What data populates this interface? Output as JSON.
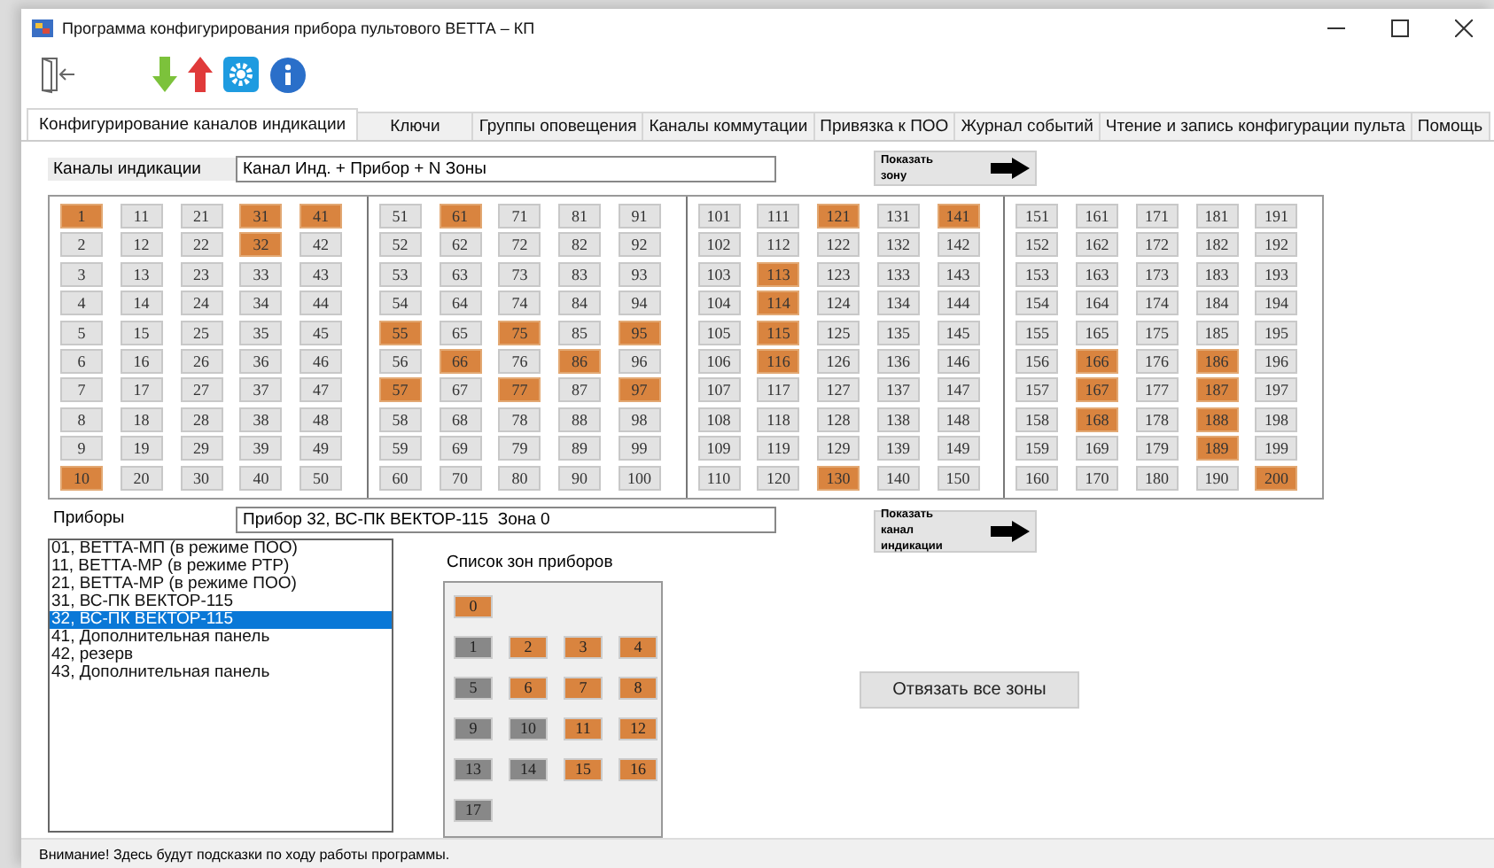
{
  "window": {
    "title": "Программа конфигурирования прибора пультового ВЕТТА – КП"
  },
  "tabs": [
    {
      "label": "Конфигурирование каналов индикации",
      "selected": true
    },
    {
      "label": "Ключи",
      "selected": false
    },
    {
      "label": "Группы оповещения",
      "selected": false
    },
    {
      "label": "Каналы коммутации",
      "selected": false
    },
    {
      "label": "Привязка к ПОО",
      "selected": false
    },
    {
      "label": "Журнал событий",
      "selected": false
    },
    {
      "label": "Чтение и запись конфигурации пульта",
      "selected": false
    },
    {
      "label": "Помощь",
      "selected": false
    }
  ],
  "channels_section": {
    "label": "Каналы индикации",
    "value": "Канал Инд. + Прибор + N Зоны",
    "show_button": "Показать зону"
  },
  "channels": [
    {
      "label": "1",
      "on": true
    },
    {
      "label": "2",
      "on": false
    },
    {
      "label": "3",
      "on": false
    },
    {
      "label": "4",
      "on": false
    },
    {
      "label": "5",
      "on": false
    },
    {
      "label": "6",
      "on": false
    },
    {
      "label": "7",
      "on": false
    },
    {
      "label": "8",
      "on": false
    },
    {
      "label": "9",
      "on": false
    },
    {
      "label": "10",
      "on": true
    },
    {
      "label": "11",
      "on": false
    },
    {
      "label": "12",
      "on": false
    },
    {
      "label": "13",
      "on": false
    },
    {
      "label": "14",
      "on": false
    },
    {
      "label": "15",
      "on": false
    },
    {
      "label": "16",
      "on": false
    },
    {
      "label": "17",
      "on": false
    },
    {
      "label": "18",
      "on": false
    },
    {
      "label": "19",
      "on": false
    },
    {
      "label": "20",
      "on": false
    },
    {
      "label": "21",
      "on": false
    },
    {
      "label": "22",
      "on": false
    },
    {
      "label": "23",
      "on": false
    },
    {
      "label": "24",
      "on": false
    },
    {
      "label": "25",
      "on": false
    },
    {
      "label": "26",
      "on": false
    },
    {
      "label": "27",
      "on": false
    },
    {
      "label": "28",
      "on": false
    },
    {
      "label": "29",
      "on": false
    },
    {
      "label": "30",
      "on": false
    },
    {
      "label": "31",
      "on": true
    },
    {
      "label": "32",
      "on": true
    },
    {
      "label": "33",
      "on": false
    },
    {
      "label": "34",
      "on": false
    },
    {
      "label": "35",
      "on": false
    },
    {
      "label": "36",
      "on": false
    },
    {
      "label": "37",
      "on": false
    },
    {
      "label": "38",
      "on": false
    },
    {
      "label": "39",
      "on": false
    },
    {
      "label": "40",
      "on": false
    },
    {
      "label": "41",
      "on": true
    },
    {
      "label": "42",
      "on": false
    },
    {
      "label": "43",
      "on": false
    },
    {
      "label": "44",
      "on": false
    },
    {
      "label": "45",
      "on": false
    },
    {
      "label": "46",
      "on": false
    },
    {
      "label": "47",
      "on": false
    },
    {
      "label": "48",
      "on": false
    },
    {
      "label": "49",
      "on": false
    },
    {
      "label": "50",
      "on": false
    },
    {
      "label": "51",
      "on": false
    },
    {
      "label": "52",
      "on": false
    },
    {
      "label": "53",
      "on": false
    },
    {
      "label": "54",
      "on": false
    },
    {
      "label": "55",
      "on": true
    },
    {
      "label": "56",
      "on": false
    },
    {
      "label": "57",
      "on": true
    },
    {
      "label": "58",
      "on": false
    },
    {
      "label": "59",
      "on": false
    },
    {
      "label": "60",
      "on": false
    },
    {
      "label": "61",
      "on": true
    },
    {
      "label": "62",
      "on": false
    },
    {
      "label": "63",
      "on": false
    },
    {
      "label": "64",
      "on": false
    },
    {
      "label": "65",
      "on": false
    },
    {
      "label": "66",
      "on": true
    },
    {
      "label": "67",
      "on": false
    },
    {
      "label": "68",
      "on": false
    },
    {
      "label": "69",
      "on": false
    },
    {
      "label": "70",
      "on": false
    },
    {
      "label": "71",
      "on": false
    },
    {
      "label": "72",
      "on": false
    },
    {
      "label": "73",
      "on": false
    },
    {
      "label": "74",
      "on": false
    },
    {
      "label": "75",
      "on": true
    },
    {
      "label": "76",
      "on": false
    },
    {
      "label": "77",
      "on": true
    },
    {
      "label": "78",
      "on": false
    },
    {
      "label": "79",
      "on": false
    },
    {
      "label": "80",
      "on": false
    },
    {
      "label": "81",
      "on": false
    },
    {
      "label": "82",
      "on": false
    },
    {
      "label": "83",
      "on": false
    },
    {
      "label": "84",
      "on": false
    },
    {
      "label": "85",
      "on": false
    },
    {
      "label": "86",
      "on": true
    },
    {
      "label": "87",
      "on": false
    },
    {
      "label": "88",
      "on": false
    },
    {
      "label": "89",
      "on": false
    },
    {
      "label": "90",
      "on": false
    },
    {
      "label": "91",
      "on": false
    },
    {
      "label": "92",
      "on": false
    },
    {
      "label": "93",
      "on": false
    },
    {
      "label": "94",
      "on": false
    },
    {
      "label": "95",
      "on": true
    },
    {
      "label": "96",
      "on": false
    },
    {
      "label": "97",
      "on": true
    },
    {
      "label": "98",
      "on": false
    },
    {
      "label": "99",
      "on": false
    },
    {
      "label": "100",
      "on": false
    },
    {
      "label": "101",
      "on": false
    },
    {
      "label": "102",
      "on": false
    },
    {
      "label": "103",
      "on": false
    },
    {
      "label": "104",
      "on": false
    },
    {
      "label": "105",
      "on": false
    },
    {
      "label": "106",
      "on": false
    },
    {
      "label": "107",
      "on": false
    },
    {
      "label": "108",
      "on": false
    },
    {
      "label": "109",
      "on": false
    },
    {
      "label": "110",
      "on": false
    },
    {
      "label": "111",
      "on": false
    },
    {
      "label": "112",
      "on": false
    },
    {
      "label": "113",
      "on": true
    },
    {
      "label": "114",
      "on": true
    },
    {
      "label": "115",
      "on": true
    },
    {
      "label": "116",
      "on": true
    },
    {
      "label": "117",
      "on": false
    },
    {
      "label": "118",
      "on": false
    },
    {
      "label": "119",
      "on": false
    },
    {
      "label": "120",
      "on": false
    },
    {
      "label": "121",
      "on": true
    },
    {
      "label": "122",
      "on": false
    },
    {
      "label": "123",
      "on": false
    },
    {
      "label": "124",
      "on": false
    },
    {
      "label": "125",
      "on": false
    },
    {
      "label": "126",
      "on": false
    },
    {
      "label": "127",
      "on": false
    },
    {
      "label": "128",
      "on": false
    },
    {
      "label": "129",
      "on": false
    },
    {
      "label": "130",
      "on": true
    },
    {
      "label": "131",
      "on": false
    },
    {
      "label": "132",
      "on": false
    },
    {
      "label": "133",
      "on": false
    },
    {
      "label": "134",
      "on": false
    },
    {
      "label": "135",
      "on": false
    },
    {
      "label": "136",
      "on": false
    },
    {
      "label": "137",
      "on": false
    },
    {
      "label": "138",
      "on": false
    },
    {
      "label": "139",
      "on": false
    },
    {
      "label": "140",
      "on": false
    },
    {
      "label": "141",
      "on": true
    },
    {
      "label": "142",
      "on": false
    },
    {
      "label": "143",
      "on": false
    },
    {
      "label": "144",
      "on": false
    },
    {
      "label": "145",
      "on": false
    },
    {
      "label": "146",
      "on": false
    },
    {
      "label": "147",
      "on": false
    },
    {
      "label": "148",
      "on": false
    },
    {
      "label": "149",
      "on": false
    },
    {
      "label": "150",
      "on": false
    },
    {
      "label": "151",
      "on": false
    },
    {
      "label": "152",
      "on": false
    },
    {
      "label": "153",
      "on": false
    },
    {
      "label": "154",
      "on": false
    },
    {
      "label": "155",
      "on": false
    },
    {
      "label": "156",
      "on": false
    },
    {
      "label": "157",
      "on": false
    },
    {
      "label": "158",
      "on": false
    },
    {
      "label": "159",
      "on": false
    },
    {
      "label": "160",
      "on": false
    },
    {
      "label": "161",
      "on": false
    },
    {
      "label": "162",
      "on": false
    },
    {
      "label": "163",
      "on": false
    },
    {
      "label": "164",
      "on": false
    },
    {
      "label": "165",
      "on": false
    },
    {
      "label": "166",
      "on": true
    },
    {
      "label": "167",
      "on": true
    },
    {
      "label": "168",
      "on": true
    },
    {
      "label": "169",
      "on": false
    },
    {
      "label": "170",
      "on": false
    },
    {
      "label": "171",
      "on": false
    },
    {
      "label": "172",
      "on": false
    },
    {
      "label": "173",
      "on": false
    },
    {
      "label": "174",
      "on": false
    },
    {
      "label": "175",
      "on": false
    },
    {
      "label": "176",
      "on": false
    },
    {
      "label": "177",
      "on": false
    },
    {
      "label": "178",
      "on": false
    },
    {
      "label": "179",
      "on": false
    },
    {
      "label": "180",
      "on": false
    },
    {
      "label": "181",
      "on": false
    },
    {
      "label": "182",
      "on": false
    },
    {
      "label": "183",
      "on": false
    },
    {
      "label": "184",
      "on": false
    },
    {
      "label": "185",
      "on": false
    },
    {
      "label": "186",
      "on": true
    },
    {
      "label": "187",
      "on": true
    },
    {
      "label": "188",
      "on": true
    },
    {
      "label": "189",
      "on": true
    },
    {
      "label": "190",
      "on": false
    },
    {
      "label": "191",
      "on": false
    },
    {
      "label": "192",
      "on": false
    },
    {
      "label": "193",
      "on": false
    },
    {
      "label": "194",
      "on": false
    },
    {
      "label": "195",
      "on": false
    },
    {
      "label": "196",
      "on": false
    },
    {
      "label": "197",
      "on": false
    },
    {
      "label": "198",
      "on": false
    },
    {
      "label": "199",
      "on": false
    },
    {
      "label": "200",
      "on": true
    }
  ],
  "devices_section": {
    "label": "Приборы",
    "value": "Прибор 32, ВС-ПК ВЕКТОР-115  Зона 0",
    "show_button": "Показать канал индикации"
  },
  "devices": [
    {
      "label": "01, ВЕТТА-МП (в режиме ПОО)",
      "selected": false
    },
    {
      "label": "11, ВЕТТА-МР (в режиме РТР)",
      "selected": false
    },
    {
      "label": "21, ВЕТТА-МР (в режиме ПОО)",
      "selected": false
    },
    {
      "label": "31, ВС-ПК ВЕКТОР-115",
      "selected": false
    },
    {
      "label": "32, ВС-ПК ВЕКТОР-115",
      "selected": true
    },
    {
      "label": "41, Дополнительная панель",
      "selected": false
    },
    {
      "label": "42, резерв",
      "selected": false
    },
    {
      "label": "43, Дополнительная панель",
      "selected": false
    }
  ],
  "zones_title": "Список зон приборов",
  "zones": [
    {
      "label": "0",
      "bound": true
    },
    {
      "label": "1",
      "bound": false
    },
    {
      "label": "2",
      "bound": true
    },
    {
      "label": "3",
      "bound": true
    },
    {
      "label": "4",
      "bound": true
    },
    {
      "label": "5",
      "bound": false
    },
    {
      "label": "6",
      "bound": true
    },
    {
      "label": "7",
      "bound": true
    },
    {
      "label": "8",
      "bound": true
    },
    {
      "label": "9",
      "bound": false
    },
    {
      "label": "10",
      "bound": false
    },
    {
      "label": "11",
      "bound": true
    },
    {
      "label": "12",
      "bound": true
    },
    {
      "label": "13",
      "bound": false
    },
    {
      "label": "14",
      "bound": false
    },
    {
      "label": "15",
      "bound": true
    },
    {
      "label": "16",
      "bound": true
    },
    {
      "label": "17",
      "bound": false
    }
  ],
  "unbind_button": "Отвязать все зоны",
  "status_bar": "Внимание! Здесь будут подсказки по ходу работы программы."
}
